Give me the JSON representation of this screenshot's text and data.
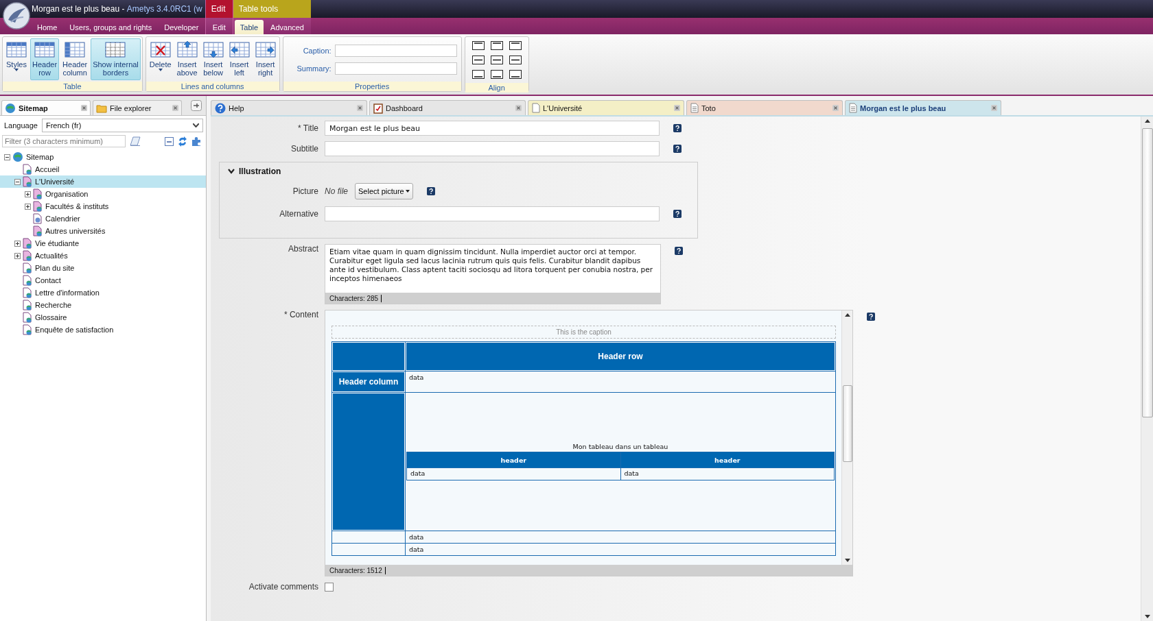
{
  "window": {
    "document_title": "Morgan est le plus beau - ",
    "app_title": "Ametys 3.4.0RC1 (w"
  },
  "ribbon": {
    "tabs": [
      {
        "label": "Home",
        "selected": false
      },
      {
        "label": "Users, groups and rights",
        "selected": false
      },
      {
        "label": "Developer",
        "selected": false
      }
    ],
    "contextual_groups": [
      {
        "label": "Edit",
        "color": "#b3122f",
        "tabs": [
          {
            "label": "Edit",
            "selected": false
          }
        ]
      },
      {
        "label": "Table tools",
        "color": "#b9a51c",
        "tabs": [
          {
            "label": "Table",
            "selected": true
          },
          {
            "label": "Advanced",
            "selected": false
          }
        ]
      }
    ],
    "groups": [
      {
        "label": "Table",
        "kind": "buttons",
        "buttons": [
          {
            "label": "Styles",
            "kind": "styles",
            "dropdown": true,
            "pressed": false
          },
          {
            "label": "Header\nrow",
            "kind": "header-row",
            "dropdown": false,
            "pressed": true
          },
          {
            "label": "Header\ncolumn",
            "kind": "header-column",
            "dropdown": false,
            "pressed": false
          },
          {
            "label": "Show internal\nborders",
            "kind": "borders",
            "dropdown": false,
            "pressed": true
          }
        ]
      },
      {
        "label": "Lines and columns",
        "kind": "buttons",
        "buttons": [
          {
            "label": "Delete",
            "kind": "delete",
            "dropdown": true,
            "pressed": false
          },
          {
            "label": "Insert\nabove",
            "kind": "insert-above",
            "dropdown": false,
            "pressed": false
          },
          {
            "label": "Insert\nbelow",
            "kind": "insert-below",
            "dropdown": false,
            "pressed": false
          },
          {
            "label": "Insert\nleft",
            "kind": "insert-left",
            "dropdown": false,
            "pressed": false
          },
          {
            "label": "Insert\nright",
            "kind": "insert-right",
            "dropdown": false,
            "pressed": false
          }
        ]
      },
      {
        "label": "Properties",
        "kind": "fields",
        "fields": [
          {
            "label": "Caption:"
          },
          {
            "label": "Summary:"
          }
        ]
      },
      {
        "label": "Align",
        "kind": "align"
      }
    ]
  },
  "sidebar": {
    "tabs": [
      {
        "label": "Sitemap",
        "kind": "globe",
        "selected": true
      },
      {
        "label": "File explorer",
        "kind": "folder",
        "selected": false
      }
    ],
    "language": {
      "label": "Language",
      "value": "French (fr)"
    },
    "filter": {
      "placeholder": "Filter (3 characters minimum)"
    },
    "tree": [
      {
        "label": "Sitemap",
        "kind": "root",
        "expanded": true,
        "selected": false,
        "children": [
          {
            "label": "Accueil",
            "kind": "page",
            "selected": false
          },
          {
            "label": "L'Université",
            "kind": "section",
            "expanded": true,
            "selected": true,
            "children": [
              {
                "label": "Organisation",
                "kind": "section",
                "expanded": false,
                "selected": false
              },
              {
                "label": "Facultés & instituts",
                "kind": "section",
                "expanded": false,
                "selected": false
              },
              {
                "label": "Calendrier",
                "kind": "calendar",
                "selected": false
              },
              {
                "label": "Autres universités",
                "kind": "section",
                "selected": false
              }
            ]
          },
          {
            "label": "Vie étudiante",
            "kind": "section",
            "expanded": false,
            "selected": false
          },
          {
            "label": "Actualités",
            "kind": "section",
            "expanded": false,
            "selected": false
          },
          {
            "label": "Plan du site",
            "kind": "page",
            "selected": false
          },
          {
            "label": "Contact",
            "kind": "page",
            "selected": false
          },
          {
            "label": "Lettre d'information",
            "kind": "page",
            "selected": false
          },
          {
            "label": "Recherche",
            "kind": "page",
            "selected": false
          },
          {
            "label": "Glossaire",
            "kind": "page",
            "selected": false
          },
          {
            "label": "Enquête de satisfaction",
            "kind": "page",
            "selected": false
          }
        ]
      }
    ]
  },
  "document_tabs": [
    {
      "label": "Help",
      "kind": "help",
      "color": "#e6e6e6",
      "selected": false
    },
    {
      "label": "Dashboard",
      "kind": "dashboard",
      "color": "#e6e6e6",
      "selected": false
    },
    {
      "label": "L'Université",
      "kind": "page",
      "color": "#f4efc6",
      "selected": false
    },
    {
      "label": "Toto",
      "kind": "document",
      "color": "#f1d9cd",
      "selected": false
    },
    {
      "label": "Morgan est le plus beau",
      "kind": "document",
      "color": "#cde5ec",
      "selected": true
    }
  ],
  "form": {
    "title": {
      "label": "* Title",
      "value": "Morgan est le plus beau"
    },
    "subtitle": {
      "label": "Subtitle"
    },
    "illustration": {
      "label": "Illustration",
      "expanded": true,
      "picture": {
        "label": "Picture",
        "status": "No file",
        "button": "Select picture"
      },
      "alternative": {
        "label": "Alternative"
      }
    },
    "abstract": {
      "label": "Abstract",
      "value": "Etiam vitae quam in quam dignissim tincidunt. Nulla imperdiet auctor orci at tempor. Curabitur eget ligula sed lacus lacinia rutrum quis quis felis. Curabitur blandit dapibus ante id vestibulum. Class aptent taciti sociosqu ad litora torquent per conubia nostra, per inceptos himenaeos",
      "counter": "Characters: 285"
    },
    "content": {
      "label": "* Content",
      "counter": "Characters: 1512",
      "table": {
        "caption": "This is the caption",
        "header_row": "Header row",
        "rows": [
          {
            "header_cell": true,
            "header": "Header column",
            "data": "data"
          },
          {
            "header_cell": true,
            "nested": {
              "caption": "Mon tableau dans un tableau",
              "headers": [
                "header",
                "header"
              ],
              "cells": [
                "data",
                "data"
              ]
            }
          },
          {
            "header_cell": false,
            "data": "data"
          },
          {
            "header_cell": false,
            "data": "data"
          }
        ]
      }
    },
    "comments": {
      "label": "Activate comments",
      "checked": false
    }
  }
}
